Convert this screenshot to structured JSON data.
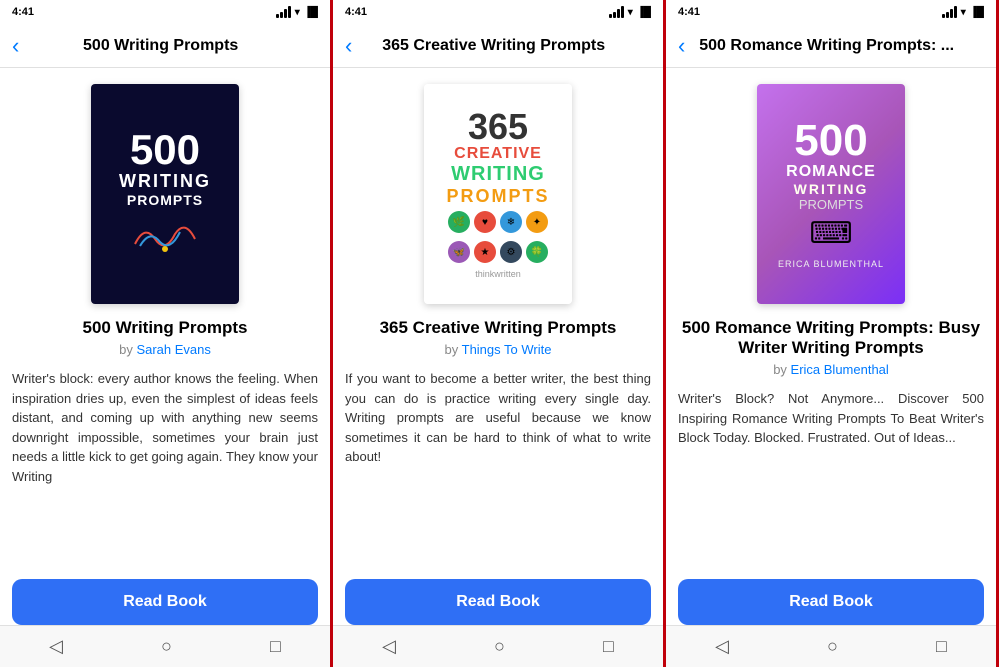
{
  "panels": [
    {
      "id": "panel1",
      "statusBar": {
        "time": "4:41",
        "signalBars": [
          2,
          3,
          4,
          5
        ],
        "wifi": true,
        "battery": "full"
      },
      "navTitle": "500 Writing Prompts",
      "bookCoverType": "500wp",
      "bookTitle": "500 Writing Prompts",
      "bookAuthor": "Sarah Evans",
      "bookDescription": "Writer's block: every author knows the feeling. When inspiration dries up, even the simplest of ideas feels distant, and coming up with anything new seems downright impossible, sometimes your brain just needs a little kick to get going again. They know your Writing",
      "readButtonLabel": "Read Book"
    },
    {
      "id": "panel2",
      "statusBar": {
        "time": "4:41",
        "signalBars": [
          2,
          3,
          4,
          5
        ],
        "wifi": true,
        "battery": "full"
      },
      "navTitle": "365 Creative Writing Prompts",
      "bookCoverType": "365cwp",
      "bookTitle": "365 Creative Writing Prompts",
      "bookAuthor": "Things To Write",
      "bookDescription": "If you want to become a better writer, the best thing you can do is practice writing every single day. Writing prompts are useful because we know sometimes it can be hard to think of what to write about!",
      "readButtonLabel": "Read Book"
    },
    {
      "id": "panel3",
      "statusBar": {
        "time": "4:41",
        "signalBars": [
          2,
          3,
          4,
          5
        ],
        "wifi": true,
        "battery": "full"
      },
      "navTitle": "500 Romance Writing Prompts: ...",
      "bookCoverType": "500rwp",
      "bookTitle": "500 Romance Writing Prompts: Busy Writer Writing Prompts",
      "bookAuthor": "Erica Blumenthal",
      "bookDescription": "Writer's Block? Not Anymore... Discover 500 Inspiring Romance Writing Prompts To Beat Writer's Block Today.\n\nBlocked.   Frustrated.   Out of Ideas...",
      "readButtonLabel": "Read Book"
    }
  ],
  "icons": {
    "back": "←",
    "backNav": "‹",
    "circle": "○",
    "square": "□",
    "triangle": "◁"
  }
}
